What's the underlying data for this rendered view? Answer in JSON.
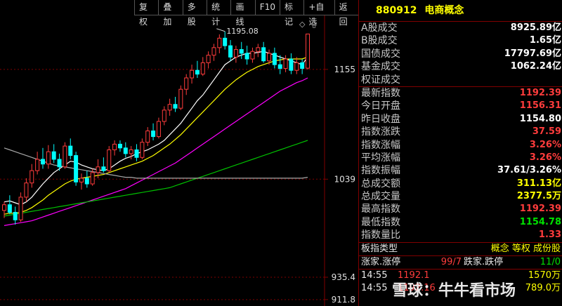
{
  "toolbar": {
    "buttons": [
      "复权",
      "叠加",
      "多股",
      "统计",
      "画线",
      "F10",
      "标记",
      "+自选",
      "返回"
    ]
  },
  "chart_data": {
    "type": "candlestick",
    "y_ticks": [
      "1155",
      "1039",
      "935.4",
      "911.8"
    ],
    "y_tick_values": [
      1155,
      1039,
      935.4,
      911.8
    ],
    "ylim": [
      905,
      1212
    ],
    "high_annotation": "1195.08",
    "high_value": 1195.08,
    "candles": [
      {
        "o": 1006,
        "h": 1015,
        "l": 998,
        "c": 1012
      },
      {
        "o": 1012,
        "h": 1022,
        "l": 1002,
        "c": 1004
      },
      {
        "o": 1004,
        "h": 1010,
        "l": 991,
        "c": 996
      },
      {
        "o": 996,
        "h": 1025,
        "l": 994,
        "c": 1020
      },
      {
        "o": 1020,
        "h": 1040,
        "l": 1015,
        "c": 1035
      },
      {
        "o": 1035,
        "h": 1055,
        "l": 1030,
        "c": 1048
      },
      {
        "o": 1048,
        "h": 1068,
        "l": 1044,
        "c": 1060
      },
      {
        "o": 1060,
        "h": 1072,
        "l": 1050,
        "c": 1055
      },
      {
        "o": 1055,
        "h": 1075,
        "l": 1050,
        "c": 1068
      },
      {
        "o": 1068,
        "h": 1076,
        "l": 1056,
        "c": 1060
      },
      {
        "o": 1060,
        "h": 1066,
        "l": 1048,
        "c": 1052
      },
      {
        "o": 1052,
        "h": 1078,
        "l": 1050,
        "c": 1074
      },
      {
        "o": 1074,
        "h": 1082,
        "l": 1060,
        "c": 1064
      },
      {
        "o": 1064,
        "h": 1068,
        "l": 1032,
        "c": 1036
      },
      {
        "o": 1036,
        "h": 1045,
        "l": 1028,
        "c": 1040
      },
      {
        "o": 1040,
        "h": 1048,
        "l": 1030,
        "c": 1034
      },
      {
        "o": 1034,
        "h": 1050,
        "l": 1032,
        "c": 1046
      },
      {
        "o": 1046,
        "h": 1060,
        "l": 1040,
        "c": 1052
      },
      {
        "o": 1052,
        "h": 1062,
        "l": 1046,
        "c": 1048
      },
      {
        "o": 1048,
        "h": 1074,
        "l": 1046,
        "c": 1070
      },
      {
        "o": 1070,
        "h": 1080,
        "l": 1064,
        "c": 1076
      },
      {
        "o": 1076,
        "h": 1080,
        "l": 1068,
        "c": 1072
      },
      {
        "o": 1072,
        "h": 1078,
        "l": 1062,
        "c": 1066
      },
      {
        "o": 1066,
        "h": 1074,
        "l": 1060,
        "c": 1070
      },
      {
        "o": 1070,
        "h": 1076,
        "l": 1058,
        "c": 1062
      },
      {
        "o": 1062,
        "h": 1082,
        "l": 1060,
        "c": 1078
      },
      {
        "o": 1078,
        "h": 1094,
        "l": 1074,
        "c": 1090
      },
      {
        "o": 1090,
        "h": 1098,
        "l": 1080,
        "c": 1084
      },
      {
        "o": 1084,
        "h": 1104,
        "l": 1082,
        "c": 1100
      },
      {
        "o": 1100,
        "h": 1116,
        "l": 1096,
        "c": 1112
      },
      {
        "o": 1112,
        "h": 1124,
        "l": 1106,
        "c": 1118
      },
      {
        "o": 1118,
        "h": 1126,
        "l": 1110,
        "c": 1114
      },
      {
        "o": 1114,
        "h": 1138,
        "l": 1112,
        "c": 1134
      },
      {
        "o": 1134,
        "h": 1150,
        "l": 1128,
        "c": 1146
      },
      {
        "o": 1146,
        "h": 1160,
        "l": 1140,
        "c": 1154
      },
      {
        "o": 1154,
        "h": 1164,
        "l": 1146,
        "c": 1150
      },
      {
        "o": 1150,
        "h": 1168,
        "l": 1148,
        "c": 1162
      },
      {
        "o": 1162,
        "h": 1174,
        "l": 1156,
        "c": 1170
      },
      {
        "o": 1170,
        "h": 1182,
        "l": 1164,
        "c": 1178
      },
      {
        "o": 1178,
        "h": 1192,
        "l": 1172,
        "c": 1188
      },
      {
        "o": 1188,
        "h": 1195,
        "l": 1176,
        "c": 1180
      },
      {
        "o": 1180,
        "h": 1186,
        "l": 1164,
        "c": 1168
      },
      {
        "o": 1168,
        "h": 1180,
        "l": 1162,
        "c": 1176
      },
      {
        "o": 1176,
        "h": 1184,
        "l": 1166,
        "c": 1172
      },
      {
        "o": 1172,
        "h": 1180,
        "l": 1160,
        "c": 1166
      },
      {
        "o": 1166,
        "h": 1178,
        "l": 1162,
        "c": 1174
      },
      {
        "o": 1174,
        "h": 1182,
        "l": 1168,
        "c": 1178
      },
      {
        "o": 1178,
        "h": 1184,
        "l": 1162,
        "c": 1164
      },
      {
        "o": 1164,
        "h": 1176,
        "l": 1160,
        "c": 1172
      },
      {
        "o": 1172,
        "h": 1178,
        "l": 1156,
        "c": 1160
      },
      {
        "o": 1160,
        "h": 1170,
        "l": 1150,
        "c": 1156
      },
      {
        "o": 1156,
        "h": 1170,
        "l": 1152,
        "c": 1166
      },
      {
        "o": 1166,
        "h": 1172,
        "l": 1150,
        "c": 1154
      },
      {
        "o": 1154,
        "h": 1168,
        "l": 1150,
        "c": 1162
      },
      {
        "o": 1162,
        "h": 1166,
        "l": 1150,
        "c": 1156
      },
      {
        "o": 1156.31,
        "h": 1192.39,
        "l": 1154.78,
        "c": 1192.39
      }
    ],
    "ma_lines": [
      {
        "color": "#ffffff",
        "values": [
          1015,
          1016,
          1014,
          1012,
          1015,
          1020,
          1027,
          1034,
          1040,
          1046,
          1050,
          1054,
          1058,
          1057,
          1054,
          1052,
          1050,
          1049,
          1048,
          1050,
          1054,
          1058,
          1061,
          1063,
          1066,
          1068,
          1070,
          1073,
          1076,
          1080,
          1086,
          1092,
          1098,
          1106,
          1114,
          1122,
          1128,
          1136,
          1144,
          1152,
          1160,
          1164,
          1168,
          1170,
          1172,
          1172,
          1173,
          1174,
          1172,
          1170,
          1168,
          1166,
          1164,
          1162,
          1160,
          1168
        ]
      },
      {
        "color": "#ffff00",
        "values": [
          1002,
          1003,
          1003,
          1004,
          1006,
          1009,
          1013,
          1017,
          1022,
          1026,
          1030,
          1034,
          1037,
          1039,
          1040,
          1041,
          1042,
          1043,
          1044,
          1046,
          1048,
          1050,
          1052,
          1054,
          1056,
          1058,
          1061,
          1064,
          1068,
          1072,
          1076,
          1081,
          1086,
          1092,
          1098,
          1104,
          1110,
          1116,
          1122,
          1128,
          1134,
          1139,
          1144,
          1148,
          1152,
          1155,
          1158,
          1160,
          1162,
          1164,
          1165,
          1166,
          1166,
          1166,
          1166,
          1168
        ]
      },
      {
        "color": "#ff00ff",
        "values": [
          990,
          991,
          992,
          993,
          994,
          995,
          997,
          999,
          1001,
          1003,
          1005,
          1007,
          1009,
          1011,
          1013,
          1015,
          1017,
          1019,
          1021,
          1023,
          1025,
          1027,
          1029,
          1032,
          1035,
          1038,
          1041,
          1044,
          1047,
          1050,
          1053,
          1056,
          1060,
          1064,
          1068,
          1072,
          1076,
          1080,
          1084,
          1088,
          1092,
          1096,
          1100,
          1104,
          1108,
          1112,
          1116,
          1120,
          1124,
          1128,
          1132,
          1135,
          1138,
          1141,
          1143,
          1146
        ]
      },
      {
        "color": "#00c000",
        "values": [
          1000,
          1001,
          1002,
          1003,
          1004,
          1005,
          1006,
          1007,
          1008,
          1009,
          1010,
          1011,
          1012,
          1013,
          1014,
          1015,
          1016,
          1017,
          1018,
          1019,
          1020,
          1021,
          1022,
          1023,
          1024,
          1025,
          1026,
          1027,
          1028,
          1029,
          1030,
          1032,
          1034,
          1036,
          1038,
          1040,
          1042,
          1044,
          1046,
          1048,
          1050,
          1052,
          1054,
          1056,
          1058,
          1060,
          1062,
          1064,
          1066,
          1068,
          1070,
          1072,
          1074,
          1076,
          1078,
          1080
        ]
      },
      {
        "color": "#a8a8a8",
        "values": [
          1072,
          1070,
          1068,
          1066,
          1064,
          1062,
          1060,
          1058,
          1056,
          1054,
          1053,
          1052,
          1051,
          1050,
          1049,
          1048,
          1047,
          1046,
          1045,
          1044,
          1043,
          1042,
          1041,
          1041,
          1040,
          1040,
          1040,
          1040,
          1040,
          1040,
          1040,
          1040,
          1040,
          1040,
          1040,
          1040,
          1040,
          1040,
          1040,
          1040,
          1040,
          1040,
          1040,
          1040,
          1040,
          1040,
          1040,
          1040,
          1040,
          1040,
          1040,
          1040,
          1040,
          1040,
          1040,
          1041
        ]
      }
    ]
  },
  "panel": {
    "code": "880912",
    "name": "电商概念",
    "rows": [
      {
        "label": "A股成交",
        "value": "8925.89亿",
        "color": "#ffffff"
      },
      {
        "label": "B股成交",
        "value": "1.65亿",
        "color": "#ffffff"
      },
      {
        "label": "国债成交",
        "value": "17797.69亿",
        "color": "#ffffff"
      },
      {
        "label": "基金成交",
        "value": "1062.24亿",
        "color": "#ffffff"
      },
      {
        "label": "权证成交",
        "value": "",
        "color": "#ffffff"
      },
      {
        "label": "最新指数",
        "value": "1192.39",
        "color": "#ff3c3c"
      },
      {
        "label": "今日开盘",
        "value": "1156.31",
        "color": "#ff3c3c"
      },
      {
        "label": "昨日收盘",
        "value": "1154.80",
        "color": "#ffffff"
      },
      {
        "label": "指数涨跌",
        "value": "37.59",
        "color": "#ff3c3c"
      },
      {
        "label": "指数涨幅",
        "value": "3.26%",
        "color": "#ff3c3c"
      },
      {
        "label": "平均涨幅",
        "value": "3.26%",
        "color": "#ff3c3c"
      },
      {
        "label": "指数振幅",
        "value": "37.61/3.26%",
        "color": "#ffffff"
      },
      {
        "label": "总成交额",
        "value": "311.13亿",
        "color": "#ffff00"
      },
      {
        "label": "总成交量",
        "value": "2377.5万",
        "color": "#ffff00"
      },
      {
        "label": "最高指数",
        "value": "1192.39",
        "color": "#ff3c3c"
      },
      {
        "label": "最低指数",
        "value": "1154.78",
        "color": "#00e000"
      },
      {
        "label": "指数量比",
        "value": "1.33",
        "color": "#ff3c3c"
      }
    ],
    "board_type_label": "板指类型",
    "board_type_value": "概念 等权 成份股",
    "stats_label1": "涨家.涨停",
    "stats_value1": "99/7",
    "stats_label2": "跌家.跌停",
    "stats_value2": "11/0",
    "ticks": [
      {
        "time": "14:55",
        "price": "1192.1",
        "vol": "1570万"
      },
      {
        "time": "14:55",
        "price": "1192.16",
        "vol": "789.0万"
      }
    ]
  },
  "watermark": "雪球：牛牛看市场"
}
